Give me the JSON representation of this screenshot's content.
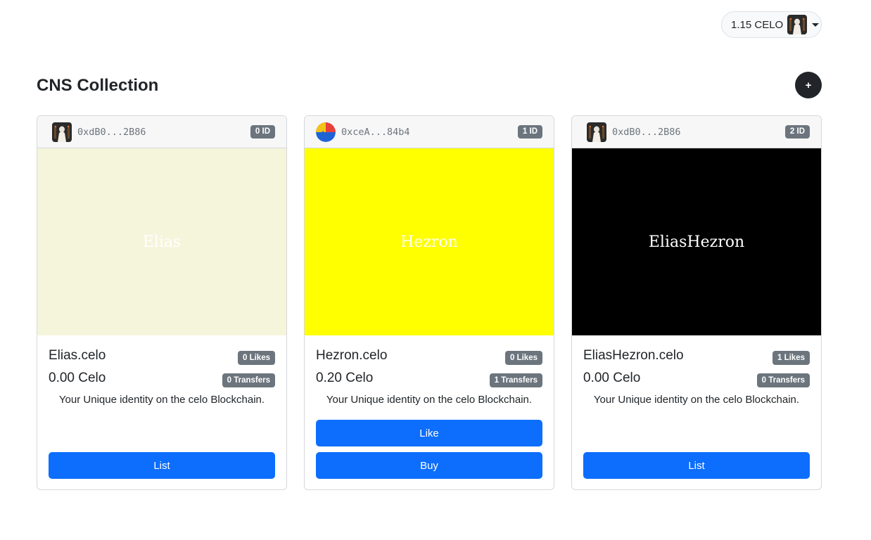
{
  "wallet": {
    "balance": "1.15 CELO"
  },
  "page": {
    "title": "CNS Collection",
    "add_label": "+"
  },
  "cards": [
    {
      "owner": "0xdB0...2B86",
      "id_badge": "0 ID",
      "art_text": "Elias",
      "art_bg": "#f5f5dc",
      "name": "Elias.celo",
      "price": "0.00 Celo",
      "likes": "0 Likes",
      "transfers": "0 Transfers",
      "description": "Your Unique identity on the celo Blockchain.",
      "action": "List"
    },
    {
      "owner": "0xceA...84b4",
      "id_badge": "1 ID",
      "art_text": "Hezron",
      "art_bg": "#ffff00",
      "name": "Hezron.celo",
      "price": "0.20 Celo",
      "likes": "0 Likes",
      "transfers": "1 Transfers",
      "description": "Your Unique identity on the celo Blockchain.",
      "like_label": "Like",
      "action": "Buy"
    },
    {
      "owner": "0xdB0...2B86",
      "id_badge": "2 ID",
      "art_text": "EliasHezron",
      "art_bg": "#000000",
      "name": "EliasHezron.celo",
      "price": "0.00 Celo",
      "likes": "1 Likes",
      "transfers": "0 Transfers",
      "description": "Your Unique identity on the celo Blockchain.",
      "action": "List"
    }
  ]
}
